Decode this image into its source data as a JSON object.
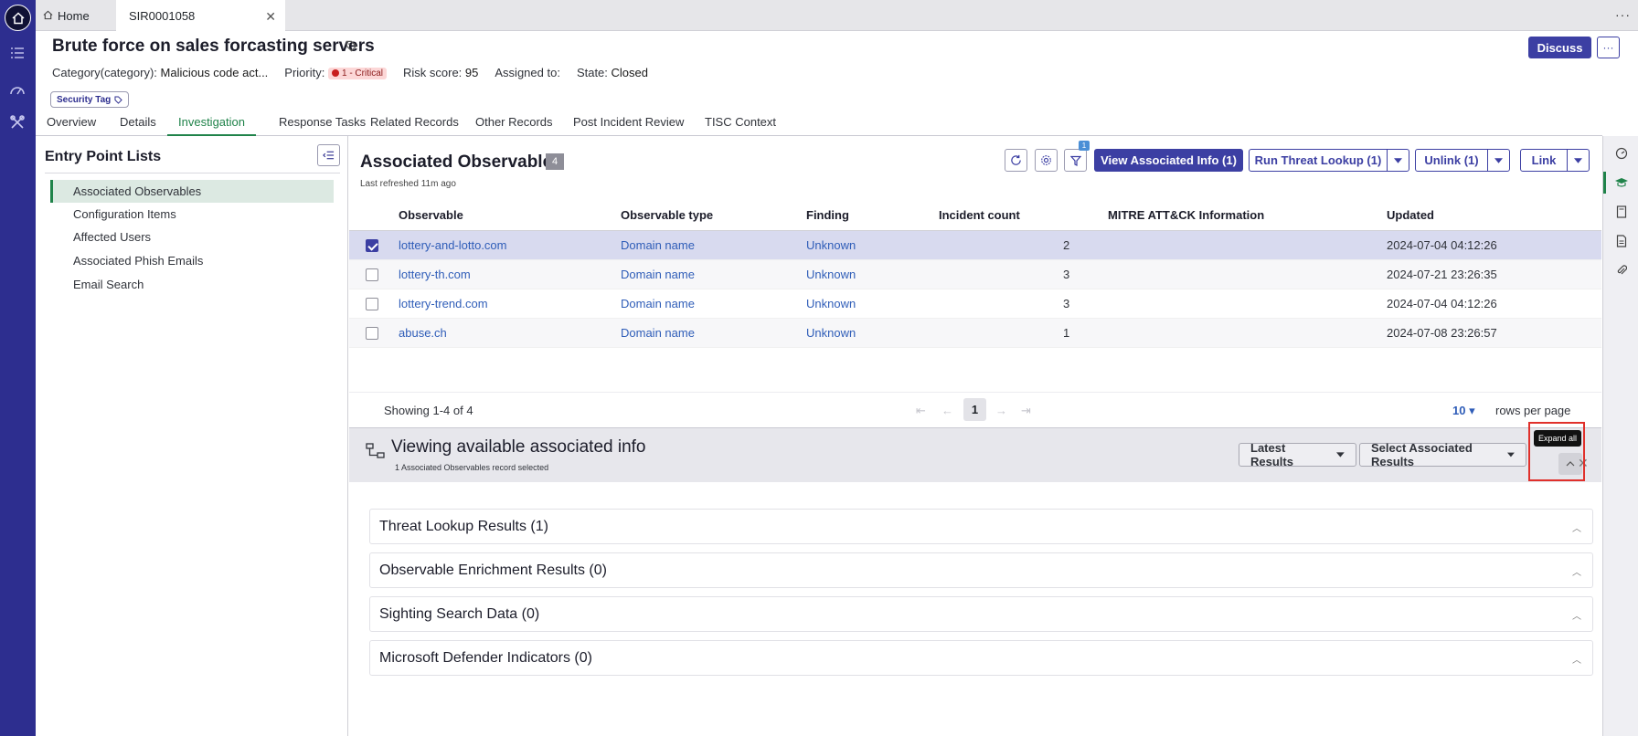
{
  "topbar": {
    "home_label": "Home",
    "record_tab": "SIR0001058",
    "more": "···"
  },
  "header": {
    "title": "Brute force on sales forcasting servers",
    "discuss": "Discuss",
    "more": "···",
    "category_label": "Category(category):",
    "category_value": "Malicious code act...",
    "priority_label": "Priority:",
    "priority_value": "1 - Critical",
    "risk_label": "Risk score:",
    "risk_value": "95",
    "assigned_label": "Assigned to:",
    "assigned_value": "",
    "state_label": "State:",
    "state_value": "Closed",
    "security_tag": "Security Tag"
  },
  "tabs": [
    "Overview",
    "Details",
    "Investigation",
    "Response Tasks",
    "Related Records",
    "Other Records",
    "Post Incident Review",
    "TISC Context"
  ],
  "entry_points": {
    "title": "Entry Point Lists",
    "items": [
      "Associated Observables",
      "Configuration Items",
      "Affected Users",
      "Associated Phish Emails",
      "Email Search"
    ]
  },
  "observables": {
    "title": "Associated Observables",
    "count": "4",
    "refreshed": "Last refreshed 11m ago",
    "filter_badge": "1",
    "view_btn": "View Associated Info (1)",
    "threat_btn": "Run Threat Lookup (1)",
    "unlink_btn": "Unlink (1)",
    "link_btn": "Link",
    "columns": [
      "Observable",
      "Observable type",
      "Finding",
      "Incident count",
      "MITRE ATT&CK Information",
      "Updated"
    ],
    "rows": [
      {
        "observable": "lottery-and-lotto.com",
        "type": "Domain name",
        "finding": "Unknown",
        "count": "2",
        "mitre": "",
        "updated": "2024-07-04 04:12:26",
        "selected": true
      },
      {
        "observable": "lottery-th.com",
        "type": "Domain name",
        "finding": "Unknown",
        "count": "3",
        "mitre": "",
        "updated": "2024-07-21 23:26:35",
        "selected": false
      },
      {
        "observable": "lottery-trend.com",
        "type": "Domain name",
        "finding": "Unknown",
        "count": "3",
        "mitre": "",
        "updated": "2024-07-04 04:12:26",
        "selected": false
      },
      {
        "observable": "abuse.ch",
        "type": "Domain name",
        "finding": "Unknown",
        "count": "1",
        "mitre": "",
        "updated": "2024-07-08 23:26:57",
        "selected": false
      }
    ],
    "showing": "Showing 1-4 of 4",
    "page": "1",
    "per_page": "10",
    "per_page_label": "rows per page"
  },
  "assoc": {
    "title": "Viewing available associated info",
    "subtitle": "1 Associated Observables record selected",
    "latest_btn": "Latest Results",
    "select_btn": "Select Associated Results",
    "tooltip": "Expand all",
    "sections": [
      "Threat Lookup Results (1)",
      "Observable Enrichment Results (0)",
      "Sighting Search Data (0)",
      "Microsoft Defender Indicators (0)"
    ]
  },
  "colors": {
    "rail": "#2d2e8f",
    "primary": "#3c3fa3",
    "active_tab": "#20834a",
    "link": "#2f5db8",
    "highlight": "#e0302b"
  }
}
